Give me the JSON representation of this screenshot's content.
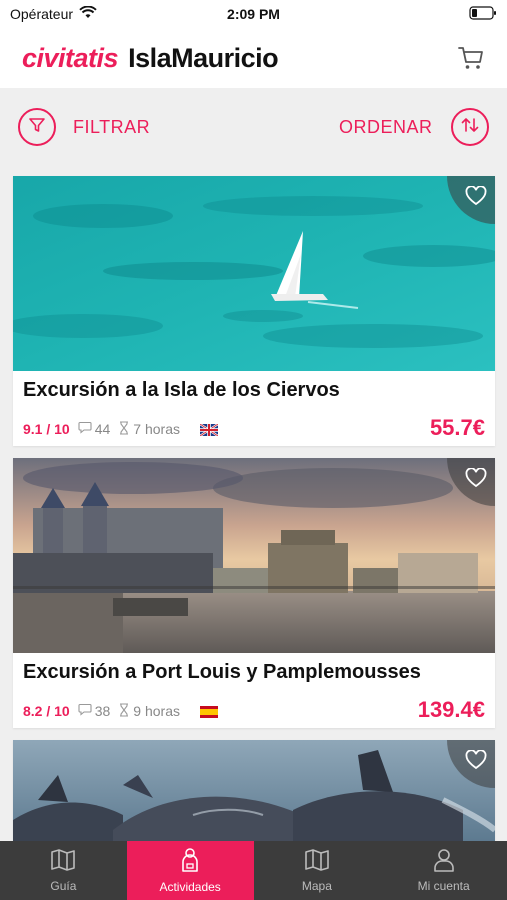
{
  "status": {
    "carrier": "Opérateur",
    "time": "2:09 PM"
  },
  "header": {
    "brand": "civitatis",
    "destination": "IslaMauricio"
  },
  "toolbar": {
    "filter_label": "FILTRAR",
    "sort_label": "ORDENAR"
  },
  "cards": [
    {
      "title": "Excursión a la Isla de los Ciervos",
      "rating": "9.1 / 10",
      "reviews": "44",
      "duration": "7 horas",
      "language": "english-flag",
      "price": "55.7€"
    },
    {
      "title": "Excursión a Port Louis y Pamplemousses",
      "rating": "8.2 / 10",
      "reviews": "38",
      "duration": "9 horas",
      "language": "spanish-flag",
      "price": "139.4€"
    },
    {
      "title": "",
      "rating": "",
      "reviews": "",
      "duration": "",
      "language": "",
      "price": ""
    }
  ],
  "tabs": [
    {
      "label": "Guía",
      "icon": "map-book-icon"
    },
    {
      "label": "Actividades",
      "icon": "activities-icon",
      "active": true
    },
    {
      "label": "Mapa",
      "icon": "map-icon"
    },
    {
      "label": "Mi cuenta",
      "icon": "user-icon"
    }
  ],
  "colors": {
    "accent": "#ec1e5a",
    "tabbar": "#3c3c3c",
    "background": "#efefef"
  }
}
